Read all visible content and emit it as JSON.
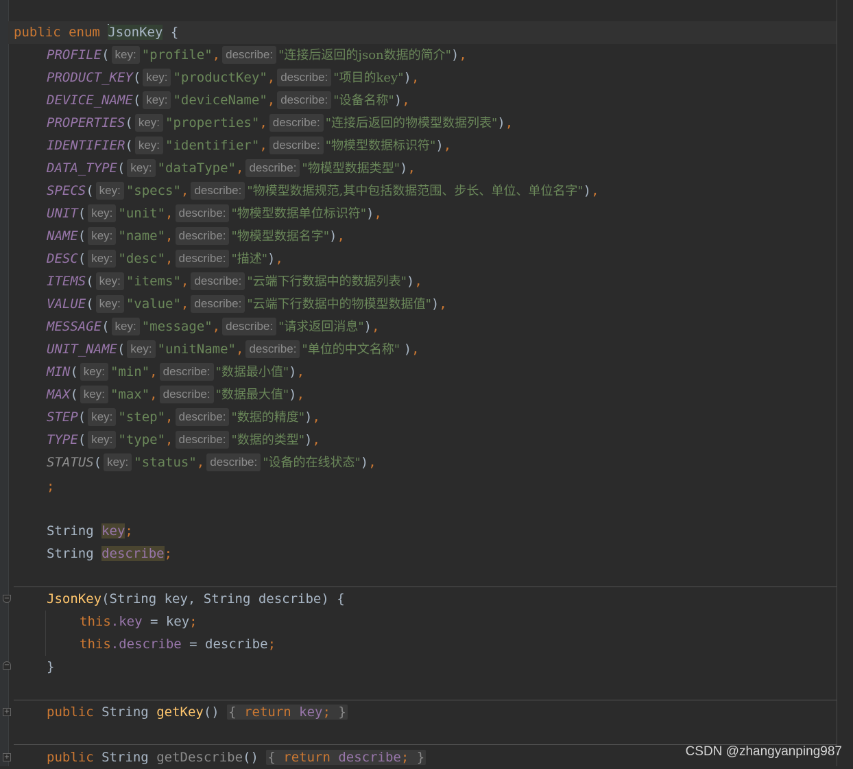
{
  "editor": {
    "enum_decl": {
      "k1": "public",
      "k2": "enum",
      "name": "JsonKey",
      "brace": "{"
    },
    "hints": {
      "key": "key:",
      "describe": "describe:"
    },
    "constants": [
      {
        "name": "PROFILE",
        "key": "\"profile\"",
        "desc": "\"连接后返回的json数据的简介\""
      },
      {
        "name": "PRODUCT_KEY",
        "key": "\"productKey\"",
        "desc": "\"项目的key\""
      },
      {
        "name": "DEVICE_NAME",
        "key": "\"deviceName\"",
        "desc": "\"设备名称\""
      },
      {
        "name": "PROPERTIES",
        "key": "\"properties\"",
        "desc": "\"连接后返回的物模型数据列表\""
      },
      {
        "name": "IDENTIFIER",
        "key": "\"identifier\"",
        "desc": "\"物模型数据标识符\""
      },
      {
        "name": "DATA_TYPE",
        "key": "\"dataType\"",
        "desc": "\"物模型数据类型\""
      },
      {
        "name": "SPECS",
        "key": "\"specs\"",
        "desc": "\"物模型数据规范,其中包括数据范围、步长、单位、单位名字\""
      },
      {
        "name": "UNIT",
        "key": "\"unit\"",
        "desc": "\"物模型数据单位标识符\""
      },
      {
        "name": "NAME",
        "key": "\"name\"",
        "desc": "\"物模型数据名字\""
      },
      {
        "name": "DESC",
        "key": "\"desc\"",
        "desc": "\"描述\""
      },
      {
        "name": "ITEMS",
        "key": "\"items\"",
        "desc": "\"云端下行数据中的数据列表\""
      },
      {
        "name": "VALUE",
        "key": "\"value\"",
        "desc": "\"云端下行数据中的物模型数据值\""
      },
      {
        "name": "MESSAGE",
        "key": "\"message\"",
        "desc": "\"请求返回消息\""
      },
      {
        "name": "UNIT_NAME",
        "key": "\"unitName\"",
        "desc": "\"单位的中文名称\" "
      },
      {
        "name": "MIN",
        "key": "\"min\"",
        "desc": "\"数据最小值\""
      },
      {
        "name": "MAX",
        "key": "\"max\"",
        "desc": "\"数据最大值\""
      },
      {
        "name": "STEP",
        "key": "\"step\"",
        "desc": "\"数据的精度\""
      },
      {
        "name": "TYPE",
        "key": "\"type\"",
        "desc": "\"数据的类型\""
      },
      {
        "name": "STATUS",
        "key": "\"status\"",
        "desc": "\"设备的在线状态\""
      }
    ],
    "semicolon": ";",
    "fields": [
      {
        "type": "String",
        "name": "key"
      },
      {
        "type": "String",
        "name": "describe"
      }
    ],
    "constructor": {
      "name": "JsonKey",
      "params": "(String key, String describe) {",
      "this": "this",
      "assign_key": ".key",
      "assign_key_rhs": " = key",
      "assign_desc": ".describe",
      "assign_desc_rhs": " = describe",
      "close": "}"
    },
    "get_key": {
      "k1": "public",
      "type": "String",
      "name": "getKey",
      "parens": "()",
      "ret": "return",
      "val": "key"
    },
    "get_describe": {
      "k1": "public",
      "type": "String",
      "name": "getDescribe",
      "parens": "()",
      "ret": "return",
      "val": "describe"
    }
  },
  "watermark": "CSDN @zhangyanping987"
}
